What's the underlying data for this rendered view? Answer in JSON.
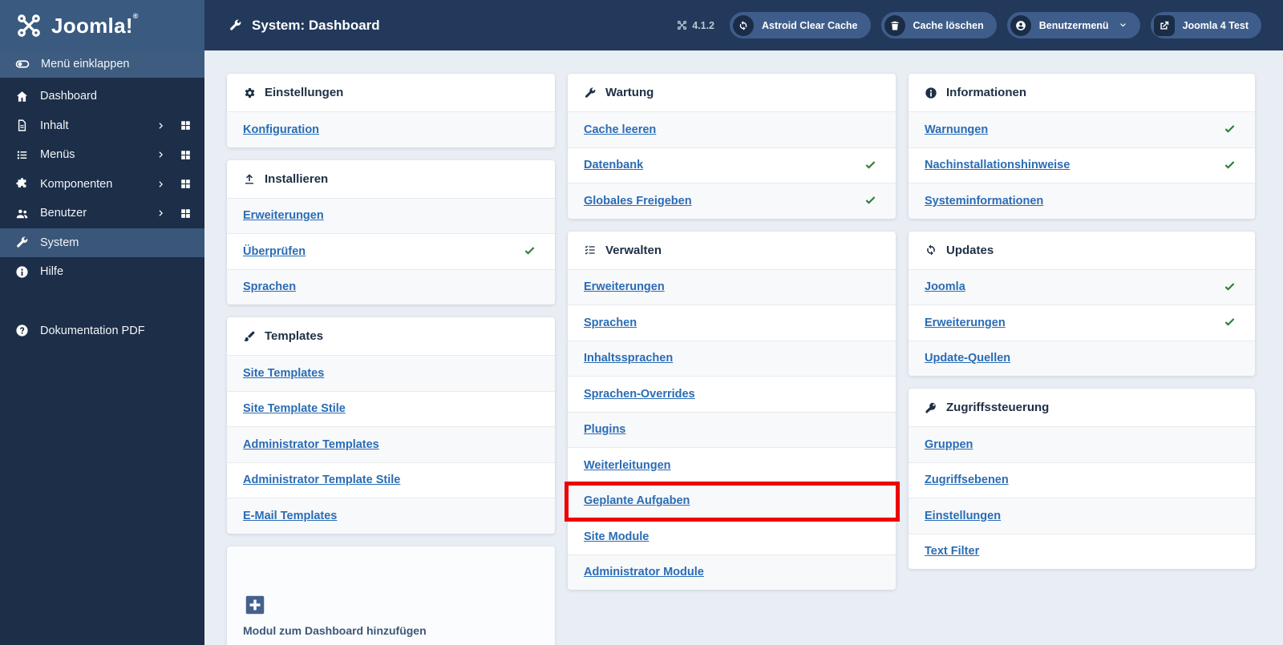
{
  "brand": {
    "name": "Joomla!",
    "trademark": "®"
  },
  "topbar": {
    "title": "System: Dashboard",
    "version": "4.1.2",
    "buttons": [
      {
        "label": "Astroid Clear Cache",
        "icon": "refresh-icon"
      },
      {
        "label": "Cache löschen",
        "icon": "trash-icon"
      },
      {
        "label": "Benutzermenü",
        "icon": "user-circle-icon",
        "has_dropdown": true
      },
      {
        "label": "Joomla 4 Test",
        "icon": "external-link-icon"
      }
    ]
  },
  "sidebar": {
    "items": [
      {
        "label": "Menü einklappen",
        "icon": "toggle-icon"
      },
      {
        "label": "Dashboard",
        "icon": "home-icon"
      },
      {
        "label": "Inhalt",
        "icon": "file-icon",
        "expandable": true
      },
      {
        "label": "Menüs",
        "icon": "list-icon",
        "expandable": true
      },
      {
        "label": "Komponenten",
        "icon": "puzzle-icon",
        "expandable": true
      },
      {
        "label": "Benutzer",
        "icon": "users-icon",
        "expandable": true
      },
      {
        "label": "System",
        "icon": "wrench-icon",
        "active": true
      },
      {
        "label": "Hilfe",
        "icon": "info-circle-icon"
      },
      {
        "label": "Dokumentation PDF",
        "icon": "question-circle-icon"
      }
    ]
  },
  "cards": {
    "einstellungen": {
      "title": "Einstellungen",
      "icon": "gear-icon",
      "links": [
        {
          "label": "Konfiguration"
        }
      ]
    },
    "installieren": {
      "title": "Installieren",
      "icon": "upload-icon",
      "links": [
        {
          "label": "Erweiterungen"
        },
        {
          "label": "Überprüfen",
          "check": true
        },
        {
          "label": "Sprachen"
        }
      ]
    },
    "templates": {
      "title": "Templates",
      "icon": "brush-icon",
      "links": [
        {
          "label": "Site Templates"
        },
        {
          "label": "Site Template Stile"
        },
        {
          "label": "Administrator Templates"
        },
        {
          "label": "Administrator Template Stile"
        },
        {
          "label": "E-Mail Templates"
        }
      ]
    },
    "add_module": {
      "label": "Modul zum Dashboard hinzufügen",
      "icon": "plus-square-icon"
    },
    "wartung": {
      "title": "Wartung",
      "icon": "wrench-icon",
      "links": [
        {
          "label": "Cache leeren"
        },
        {
          "label": "Datenbank",
          "check": true
        },
        {
          "label": "Globales Freigeben",
          "check": true
        }
      ]
    },
    "verwalten": {
      "title": "Verwalten",
      "icon": "tasks-icon",
      "links": [
        {
          "label": "Erweiterungen"
        },
        {
          "label": "Sprachen"
        },
        {
          "label": "Inhaltssprachen"
        },
        {
          "label": "Sprachen-Overrides"
        },
        {
          "label": "Plugins"
        },
        {
          "label": "Weiterleitungen"
        },
        {
          "label": "Geplante Aufgaben",
          "highlighted": true
        },
        {
          "label": "Site Module"
        },
        {
          "label": "Administrator Module"
        }
      ]
    },
    "informationen": {
      "title": "Informationen",
      "icon": "info-circle-icon",
      "links": [
        {
          "label": "Warnungen",
          "check": true
        },
        {
          "label": "Nachinstallationshinweise",
          "check": true
        },
        {
          "label": "Systeminformationen"
        }
      ]
    },
    "updates": {
      "title": "Updates",
      "icon": "sync-icon",
      "links": [
        {
          "label": "Joomla",
          "check": true
        },
        {
          "label": "Erweiterungen",
          "check": true
        },
        {
          "label": "Update-Quellen"
        }
      ]
    },
    "zugriffssteuerung": {
      "title": "Zugriffssteuerung",
      "icon": "key-icon",
      "links": [
        {
          "label": "Gruppen"
        },
        {
          "label": "Zugriffsebenen"
        },
        {
          "label": "Einstellungen"
        },
        {
          "label": "Text Filter"
        }
      ]
    }
  },
  "colors": {
    "topbar": "#22395b",
    "sidebar": "#1c2e48",
    "logo_bg": "#3a5a80",
    "active_row": "#3a5678",
    "content_bg": "#e9eef5",
    "link": "#2a6cb5",
    "check_green": "#2e7d32",
    "highlight_red": "#ee0000",
    "pill": "#3f5d8a"
  }
}
